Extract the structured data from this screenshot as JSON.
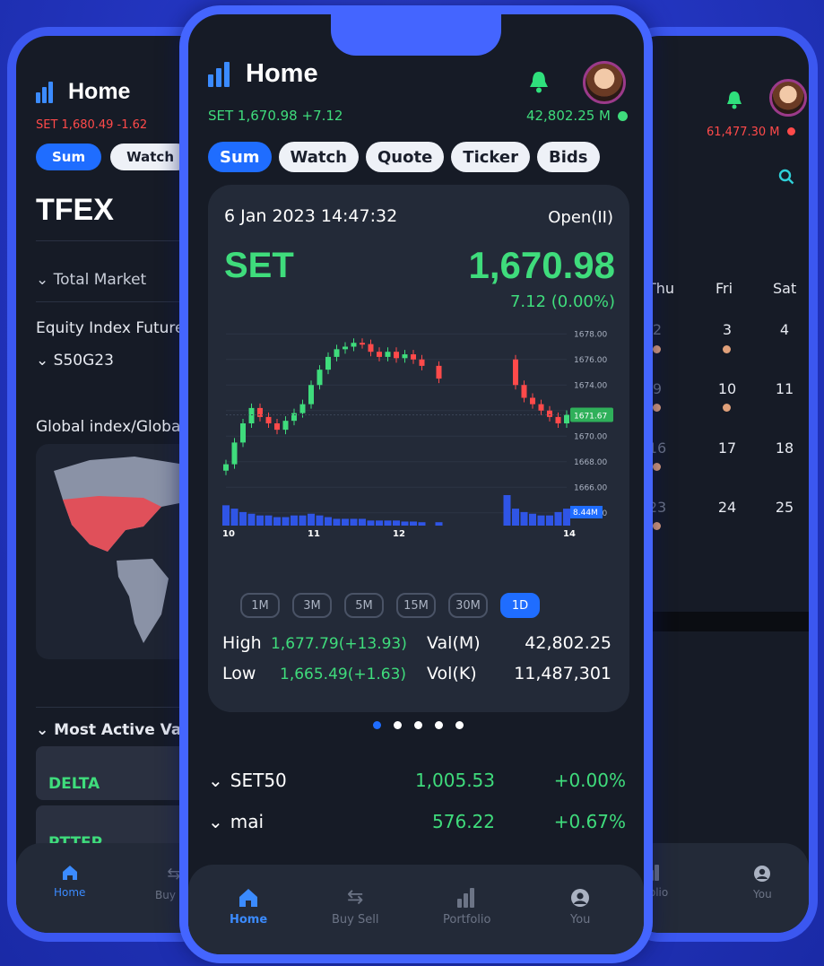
{
  "left_phone": {
    "title": "Home",
    "set_ticker": "SET 1,680.49 -1.62",
    "chips": [
      "Sum",
      "Watch"
    ],
    "section": "TFEX",
    "total_market": "Total Market",
    "equity_index_futures": "Equity Index Futures",
    "s50": "S50G23",
    "global_index": "Global index/Globa",
    "most_active": "Most Active Va",
    "stocks": [
      "DELTA",
      "PTTEP"
    ],
    "tabs": [
      "Home",
      "Buy Se"
    ]
  },
  "center_phone": {
    "title": "Home",
    "set_ticker": "SET 1,670.98 +7.12",
    "market_value": "42,802.25 M",
    "chips": [
      "Sum",
      "Watch",
      "Quote",
      "Ticker",
      "Bids"
    ],
    "datetime": "6 Jan 2023 14:47:32",
    "market_status": "Open(II)",
    "index_name": "SET",
    "index_value": "1,670.98",
    "index_change": "7.12 (0.00%)",
    "timeframes": [
      "1M",
      "3M",
      "5M",
      "15M",
      "30M",
      "1D"
    ],
    "high_label": "High",
    "high_value": "1,677.79(+13.93)",
    "low_label": "Low",
    "low_value": "1,665.49(+1.63)",
    "val_label": "Val(M)",
    "val_value": "42,802.25",
    "vol_label": "Vol(K)",
    "vol_value": "11,487,301",
    "indices": [
      {
        "name": "SET50",
        "value": "1,005.53",
        "change": "+0.00%"
      },
      {
        "name": "mai",
        "value": "576.22",
        "change": "+0.67%"
      }
    ],
    "tabs": [
      "Home",
      "Buy Sell",
      "Portfolio",
      "You"
    ]
  },
  "right_phone": {
    "market_value": "61,477.30 M",
    "weekdays": [
      "Thu",
      "Fri",
      "Sat"
    ],
    "dates": [
      [
        "2",
        "3",
        "4"
      ],
      [
        "9",
        "10",
        "11"
      ],
      [
        "16",
        "17",
        "18"
      ],
      [
        "23",
        "24",
        "25"
      ]
    ],
    "tabs": [
      "rtfolio",
      "You"
    ]
  },
  "chart_data": {
    "type": "line",
    "title": "",
    "xlabel": "",
    "ylabel": "",
    "x_ticks": [
      "10",
      "11",
      "12",
      "14"
    ],
    "y_ticks": [
      "1678.00",
      "1676.00",
      "1674.00",
      "1672.00",
      "1670.00",
      "1668.00",
      "1666.00",
      "1664.00"
    ],
    "ylim": [
      1663,
      1679
    ],
    "current_price_label": "1671.67",
    "volume_label": "8.44M",
    "series": [
      {
        "x": [
          10.0,
          10.1,
          10.2,
          10.3,
          10.4,
          10.5,
          10.6,
          10.7,
          10.8,
          10.9,
          11.0,
          11.1,
          11.2,
          11.3,
          11.4,
          11.5,
          11.6,
          11.7,
          11.8,
          11.9,
          12.0,
          12.1,
          12.2,
          12.3,
          12.5,
          13.3,
          13.4,
          13.5,
          13.6,
          13.7,
          13.8,
          13.9,
          14.0
        ],
        "values": [
          1667.8,
          1669.5,
          1671.0,
          1672.2,
          1671.5,
          1671.0,
          1670.5,
          1671.2,
          1671.8,
          1672.5,
          1674.0,
          1675.2,
          1676.2,
          1676.8,
          1677.0,
          1677.3,
          1677.2,
          1676.6,
          1676.2,
          1676.6,
          1676.1,
          1676.4,
          1676.0,
          1675.5,
          1674.5,
          1676.0,
          1674.0,
          1673.0,
          1672.5,
          1672.0,
          1671.5,
          1671.0,
          1671.67
        ]
      }
    ],
    "volume": {
      "x": [
        10.0,
        10.1,
        10.2,
        10.3,
        10.4,
        10.5,
        10.6,
        10.7,
        10.8,
        10.9,
        11.0,
        11.1,
        11.2,
        11.3,
        11.4,
        11.5,
        11.6,
        11.7,
        11.8,
        11.9,
        12.0,
        12.1,
        12.2,
        12.3,
        12.5,
        13.3,
        13.4,
        13.5,
        13.6,
        13.7,
        13.8,
        13.9,
        14.0
      ],
      "values": [
        0.6,
        0.5,
        0.4,
        0.35,
        0.3,
        0.3,
        0.25,
        0.25,
        0.3,
        0.3,
        0.35,
        0.3,
        0.25,
        0.2,
        0.2,
        0.2,
        0.2,
        0.15,
        0.15,
        0.15,
        0.15,
        0.12,
        0.12,
        0.1,
        0.1,
        0.9,
        0.5,
        0.4,
        0.35,
        0.3,
        0.3,
        0.4,
        0.5
      ]
    }
  },
  "colors": {
    "background": "#2436c2",
    "frame": "#4465ff",
    "panel": "#161b26",
    "card": "#232a38",
    "accent_blue": "#1f6dff",
    "up_green": "#3fdc7c",
    "down_red": "#ff4a4a",
    "bell_green": "#2fe07c"
  }
}
